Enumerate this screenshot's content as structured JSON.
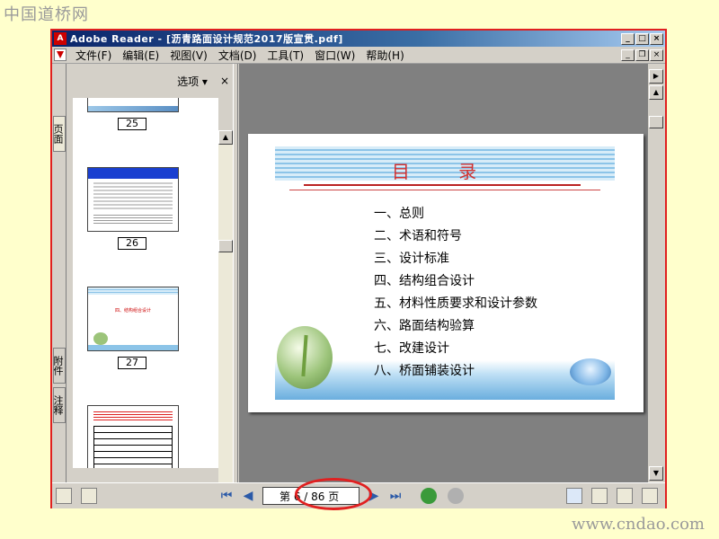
{
  "watermark": {
    "site_logo": "中国道桥网",
    "site_url": "www.cndao.com"
  },
  "window": {
    "title": "Adobe Reader - [沥青路面设计规范2017版宣贯.pdf]",
    "controls": [
      "_",
      "□",
      "×"
    ],
    "doc_controls": [
      "_",
      "❐",
      "×"
    ]
  },
  "menu": {
    "items": [
      "文件(F)",
      "编辑(E)",
      "视图(V)",
      "文档(D)",
      "工具(T)",
      "窗口(W)",
      "帮助(H)"
    ]
  },
  "left_tabs": [
    "页面",
    "附件",
    "注释"
  ],
  "thumbnail_panel": {
    "options_label": "选项 ▾",
    "close_label": "×",
    "pages": [
      "25",
      "26",
      "27"
    ]
  },
  "slide": {
    "title": "目 录",
    "toc": [
      "一、总则",
      "二、术语和符号",
      "三、设计标准",
      "四、结构组合设计",
      "五、材料性质要求和设计参数",
      "六、路面结构验算",
      "七、改建设计",
      "八、桥面铺装设计"
    ]
  },
  "thumb27_text": "四、结构组合设计",
  "status": {
    "page_indicator": "第 6 / 86 页",
    "nav_first": "⏮",
    "nav_prev": "◀",
    "nav_next": "▶",
    "nav_last": "⏭"
  },
  "colors": {
    "accent_red": "#e02020",
    "title_red": "#d03030",
    "titlebar_blue": "#0a246a"
  }
}
